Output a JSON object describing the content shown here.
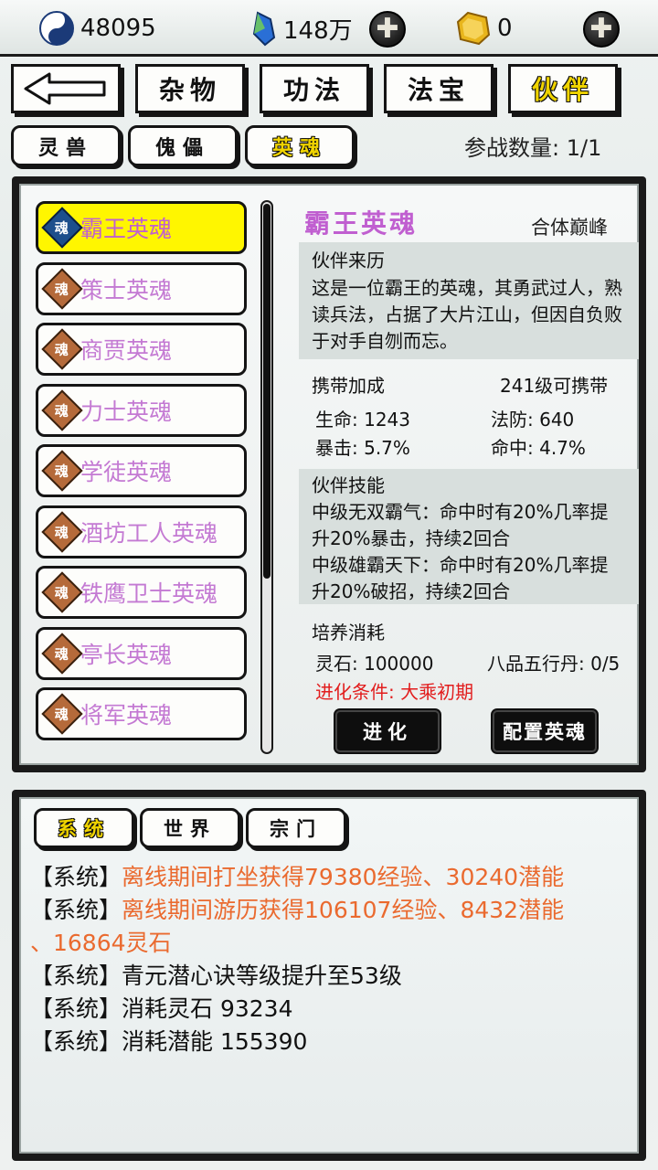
{
  "resources": {
    "yinyang_value": "48095",
    "crystal_value": "148万",
    "gold_value": "0"
  },
  "main_tabs": [
    "杂物",
    "功法",
    "法宝",
    "伙伴"
  ],
  "sub_tabs": [
    "灵兽",
    "傀儡",
    "英魂"
  ],
  "party_count_label": "参战数量: 1/1",
  "soul_icon_char": "魂",
  "hero_list": [
    "霸王英魂",
    "策士英魂",
    "商贾英魂",
    "力士英魂",
    "学徒英魂",
    "酒坊工人英魂",
    "铁鹰卫士英魂",
    "亭长英魂",
    "将军英魂"
  ],
  "detail": {
    "name": "霸王英魂",
    "realm": "合体巅峰",
    "origin_title": "伙伴来历",
    "origin_lines": [
      "这是一位霸王的英魂，其勇武过人，熟",
      "读兵法，占据了大片江山，但因自负败",
      "于对手自刎而忘。"
    ],
    "bonus_title": "携带加成",
    "carry_level": "241级可携带",
    "stats": {
      "hp": "生命: 1243",
      "mdef": "法防: 640",
      "crit": "暴击: 5.7%",
      "hit": "命中: 4.7%"
    },
    "skills_title": "伙伴技能",
    "skill_lines": [
      "中级无双霸气：命中时有20%几率提",
      "升20%暴击，持续2回合",
      "中级雄霸天下：命中时有20%几率提",
      "升20%破招，持续2回合"
    ],
    "cost_title": "培养消耗",
    "cost_stone": "灵石: 100000",
    "cost_pill": "八品五行丹: 0/5",
    "evolve_condition": "进化条件: 大乘初期",
    "evolve_button": "进化",
    "config_button": "配置英魂"
  },
  "chat": {
    "tabs": [
      "系统",
      "世界",
      "宗门"
    ],
    "lines": [
      {
        "prefix": "【系统】",
        "text": "离线期间打坐获得79380经验、30240潜能"
      },
      {
        "prefix": "【系统】",
        "text": "离线期间游历获得106107经验、8432潜能"
      },
      {
        "prefix": "",
        "text": "、16864灵石"
      },
      {
        "prefix": "【系统】",
        "text": "青元潜心诀等级提升至53级"
      },
      {
        "prefix": "【系统】",
        "text": "消耗灵石 93234"
      },
      {
        "prefix": "【系统】",
        "text": "消耗潜能 155390"
      }
    ]
  },
  "colors": {
    "accent_yellow": "#f0d400",
    "hero_name_purple": "#c47ad3",
    "warning_red": "#e21d1d",
    "log_orange": "#ea6a2f"
  }
}
